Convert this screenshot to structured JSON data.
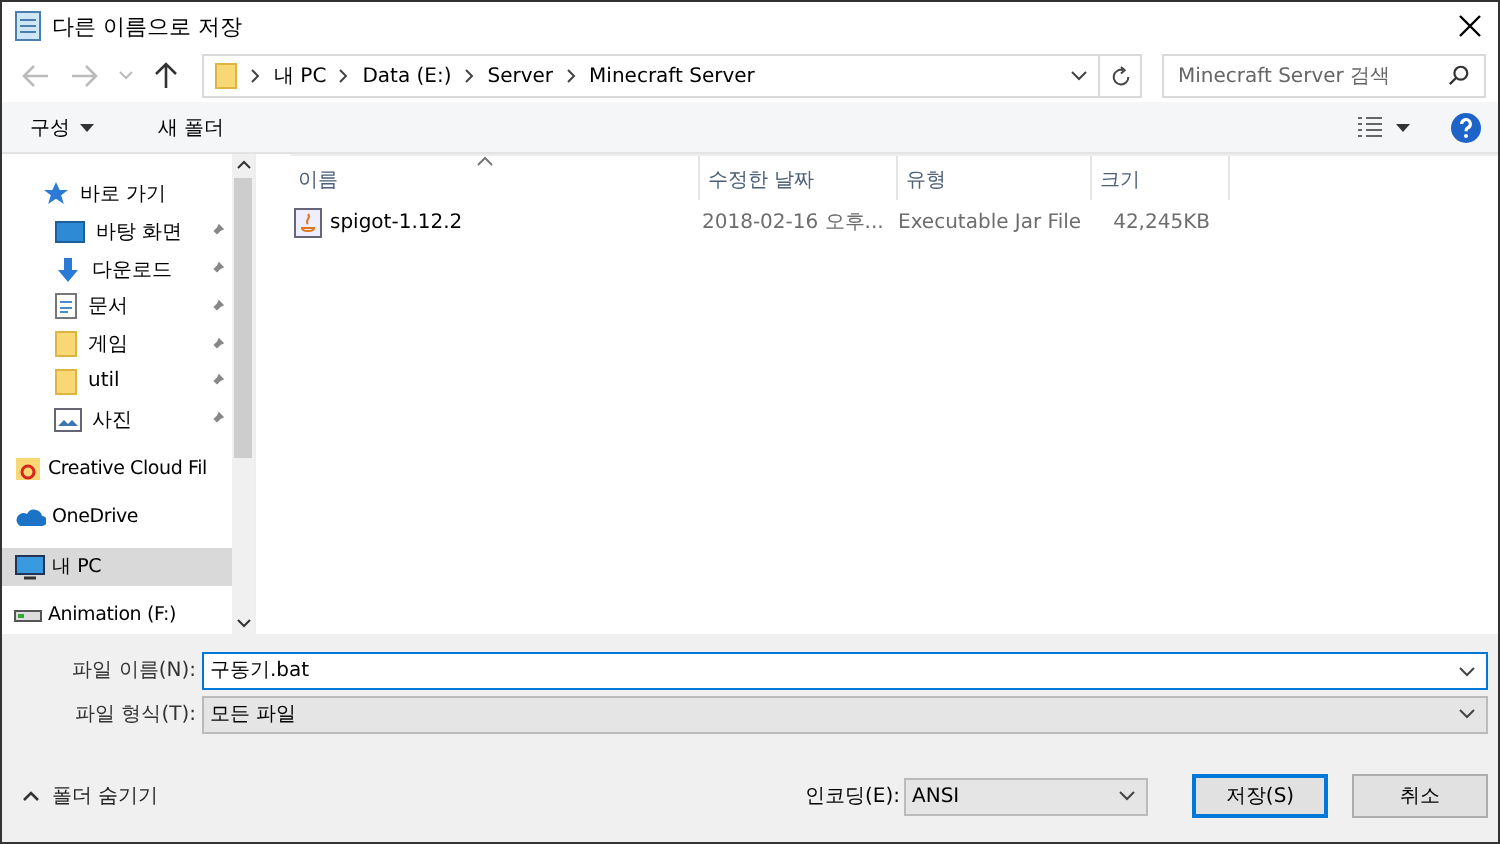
{
  "window": {
    "title": "다른 이름으로 저장"
  },
  "address": {
    "path": [
      "내 PC",
      "Data (E:)",
      "Server",
      "Minecraft Server"
    ],
    "search_placeholder": "Minecraft Server 검색"
  },
  "toolbar": {
    "organize": "구성",
    "new_folder": "새 폴더"
  },
  "sidebar": {
    "items": [
      {
        "label": "바로 가기",
        "kind": "star",
        "selected": false,
        "children": [
          {
            "label": "바탕 화면",
            "kind": "desktop",
            "selected": false
          },
          {
            "label": "다운로드",
            "kind": "download",
            "selected": false
          },
          {
            "label": "문서",
            "kind": "document",
            "selected": false
          },
          {
            "label": "게임",
            "kind": "folder",
            "selected": false
          },
          {
            "label": "util",
            "kind": "folder",
            "selected": false
          },
          {
            "label": "사진",
            "kind": "pictures",
            "selected": false
          }
        ]
      },
      {
        "label": "Creative Cloud Fil",
        "kind": "cloud-files",
        "selected": false
      },
      {
        "label": "OneDrive",
        "kind": "onedrive",
        "selected": false
      },
      {
        "label": "내 PC",
        "kind": "pc",
        "selected": true
      },
      {
        "label": "Animation (F:)",
        "kind": "drive",
        "selected": false
      }
    ]
  },
  "table": {
    "columns": [
      "이름",
      "수정한 날짜",
      "유형",
      "크기"
    ],
    "rows": [
      {
        "name": "spigot-1.12.2",
        "modified": "2018-02-16 오후...",
        "type": "Executable Jar File",
        "size": "42,245KB"
      }
    ]
  },
  "form": {
    "filename_label": "파일 이름(N):",
    "filename": "구동기.bat",
    "filetype_label": "파일 형식(T):",
    "filetype": "모든 파일",
    "hide_folders": "폴더 숨기기",
    "encoding_label": "인코딩(E):",
    "encoding": "ANSI",
    "save": "저장(S)",
    "cancel": "취소"
  }
}
